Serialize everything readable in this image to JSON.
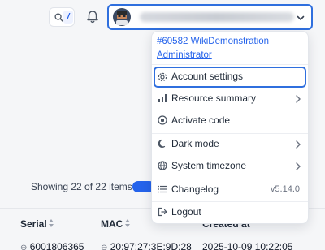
{
  "topbar": {
    "shortcut_key": "/",
    "search_icon": "search-icon",
    "notification_icon": "bell-icon"
  },
  "profile": {
    "avatar_icon": "avatar",
    "chevron_icon": "chevron-down-icon"
  },
  "dropdown": {
    "user_line1": "#60582 WikiDemonstration",
    "user_line2": "Administrator",
    "items": [
      {
        "label": "Account settings",
        "icon": "gear-icon"
      },
      {
        "label": "Resource summary",
        "icon": "bar-chart-icon"
      },
      {
        "label": "Activate code",
        "icon": "activate-icon"
      },
      {
        "label": "Dark mode",
        "icon": "moon-icon"
      },
      {
        "label": "System timezone",
        "icon": "globe-icon"
      },
      {
        "label": "Changelog",
        "icon": "list-icon",
        "version": "v5.14.0"
      },
      {
        "label": "Logout",
        "icon": "logout-icon"
      }
    ]
  },
  "table": {
    "showing": "Showing 22 of 22 items",
    "columns": [
      "Serial",
      "MAC",
      "Created at"
    ],
    "first_row": [
      "6001806365",
      "20:97:27:3E:9D:28",
      "2025-10-09 10:22:05"
    ]
  },
  "colors": {
    "accent": "#2f6fde",
    "link": "#2563eb"
  }
}
